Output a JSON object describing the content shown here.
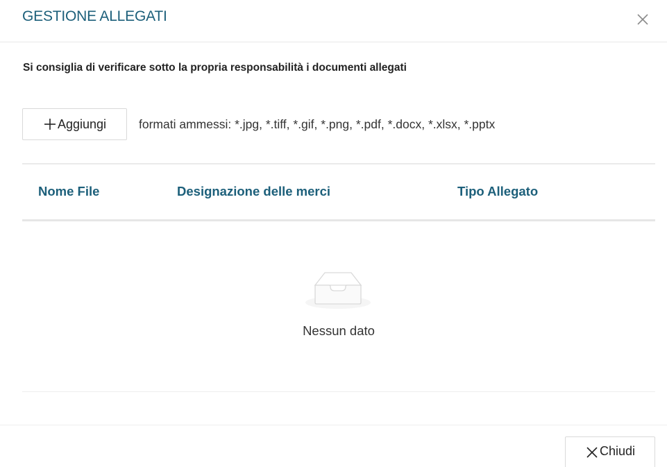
{
  "modal": {
    "title": "GESTIONE ALLEGATI",
    "close_icon": "close-icon"
  },
  "warning": "Si consiglia di verificare sotto la propria responsabilità i documenti allegati",
  "upload": {
    "add_label": "Aggiungi",
    "add_icon": "plus-icon",
    "formats_text": "formati ammessi: *.jpg, *.tiff, *.gif, *.png, *.pdf, *.docx, *.xlsx, *.pptx"
  },
  "table": {
    "columns": [
      "Nome File",
      "Designazione delle merci",
      "Tipo Allegato"
    ],
    "empty_icon": "empty-inbox-icon",
    "empty_text": "Nessun dato"
  },
  "footer": {
    "close_label": "Chiudi",
    "close_icon": "close-icon"
  },
  "colors": {
    "title": "#1c5f7a",
    "header_text": "#1c5f7a",
    "border": "#d9d9d9"
  }
}
